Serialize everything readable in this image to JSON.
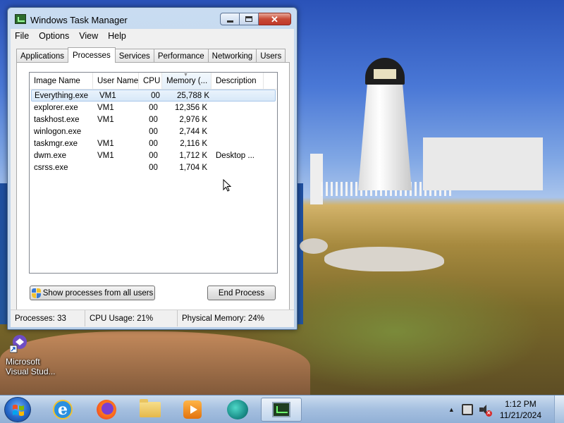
{
  "window": {
    "title": "Windows Task Manager",
    "menu": [
      "File",
      "Options",
      "View",
      "Help"
    ],
    "tabs": [
      "Applications",
      "Processes",
      "Services",
      "Performance",
      "Networking",
      "Users"
    ],
    "active_tab": "Processes",
    "columns": [
      "Image Name",
      "User Name",
      "CPU",
      "Memory (...",
      "Description"
    ],
    "processes": [
      {
        "image": "Everything.exe",
        "user": "VM1",
        "cpu": "00",
        "memory": "25,788 K",
        "description": ""
      },
      {
        "image": "explorer.exe",
        "user": "VM1",
        "cpu": "00",
        "memory": "12,356 K",
        "description": ""
      },
      {
        "image": "taskhost.exe",
        "user": "VM1",
        "cpu": "00",
        "memory": "2,976 K",
        "description": ""
      },
      {
        "image": "winlogon.exe",
        "user": "",
        "cpu": "00",
        "memory": "2,744 K",
        "description": ""
      },
      {
        "image": "taskmgr.exe",
        "user": "VM1",
        "cpu": "00",
        "memory": "2,116 K",
        "description": ""
      },
      {
        "image": "dwm.exe",
        "user": "VM1",
        "cpu": "00",
        "memory": "1,712 K",
        "description": "Desktop ..."
      },
      {
        "image": "csrss.exe",
        "user": "",
        "cpu": "00",
        "memory": "1,704 K",
        "description": ""
      }
    ],
    "selected_row": "Everything.exe",
    "show_all_button": "Show processes from all users",
    "end_process_button": "End Process",
    "status": {
      "processes": "Processes: 33",
      "cpu": "CPU Usage: 21%",
      "memory": "Physical Memory: 24%"
    }
  },
  "desktop": {
    "icon_label_line1": "Microsoft",
    "icon_label_line2": "Visual Stud..."
  },
  "taskbar": {
    "pinned": [
      "start-orb",
      "internet-explorer-icon",
      "firefox-icon",
      "file-explorer-icon",
      "media-player-icon",
      "visual-studio-icon",
      "task-manager-icon"
    ],
    "clock_time": "1:12 PM",
    "clock_date": "11/21/2024"
  },
  "colors": {
    "titlebar": "#b8cfe9",
    "close_button": "#c74a36",
    "selection": "#d7e8f8",
    "taskbar": "#a0bcde"
  }
}
